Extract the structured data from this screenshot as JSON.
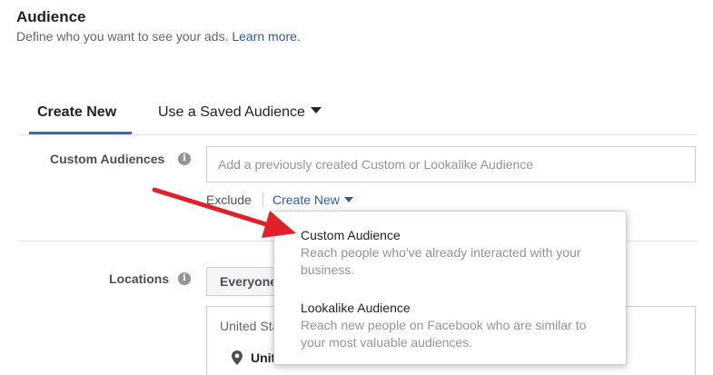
{
  "section": {
    "title": "Audience",
    "description": "Define who you want to see your ads.",
    "learn_more": "Learn more."
  },
  "tabs": [
    {
      "label": "Create New",
      "active": true
    },
    {
      "label": "Use a Saved Audience",
      "active": false
    }
  ],
  "custom_audiences": {
    "label": "Custom Audiences",
    "info_icon": "info-icon",
    "placeholder": "Add a previously created Custom or Lookalike Audience",
    "value": "",
    "exclude_label": "Exclude",
    "create_new_label": "Create New"
  },
  "dropdown": {
    "items": [
      {
        "title": "Custom Audience",
        "description": "Reach people who've already interacted with your business."
      },
      {
        "title": "Lookalike Audience",
        "description": "Reach new people on Facebook who are similar to your most valuable audiences."
      }
    ]
  },
  "locations": {
    "label": "Locations",
    "info_icon": "info-icon",
    "selected_option": "Everyone in this location",
    "country": "United States",
    "item": "United States"
  },
  "annotation": {
    "arrow_color": "#e0202a"
  },
  "colors": {
    "accent": "#4267b2",
    "link": "#365899"
  }
}
